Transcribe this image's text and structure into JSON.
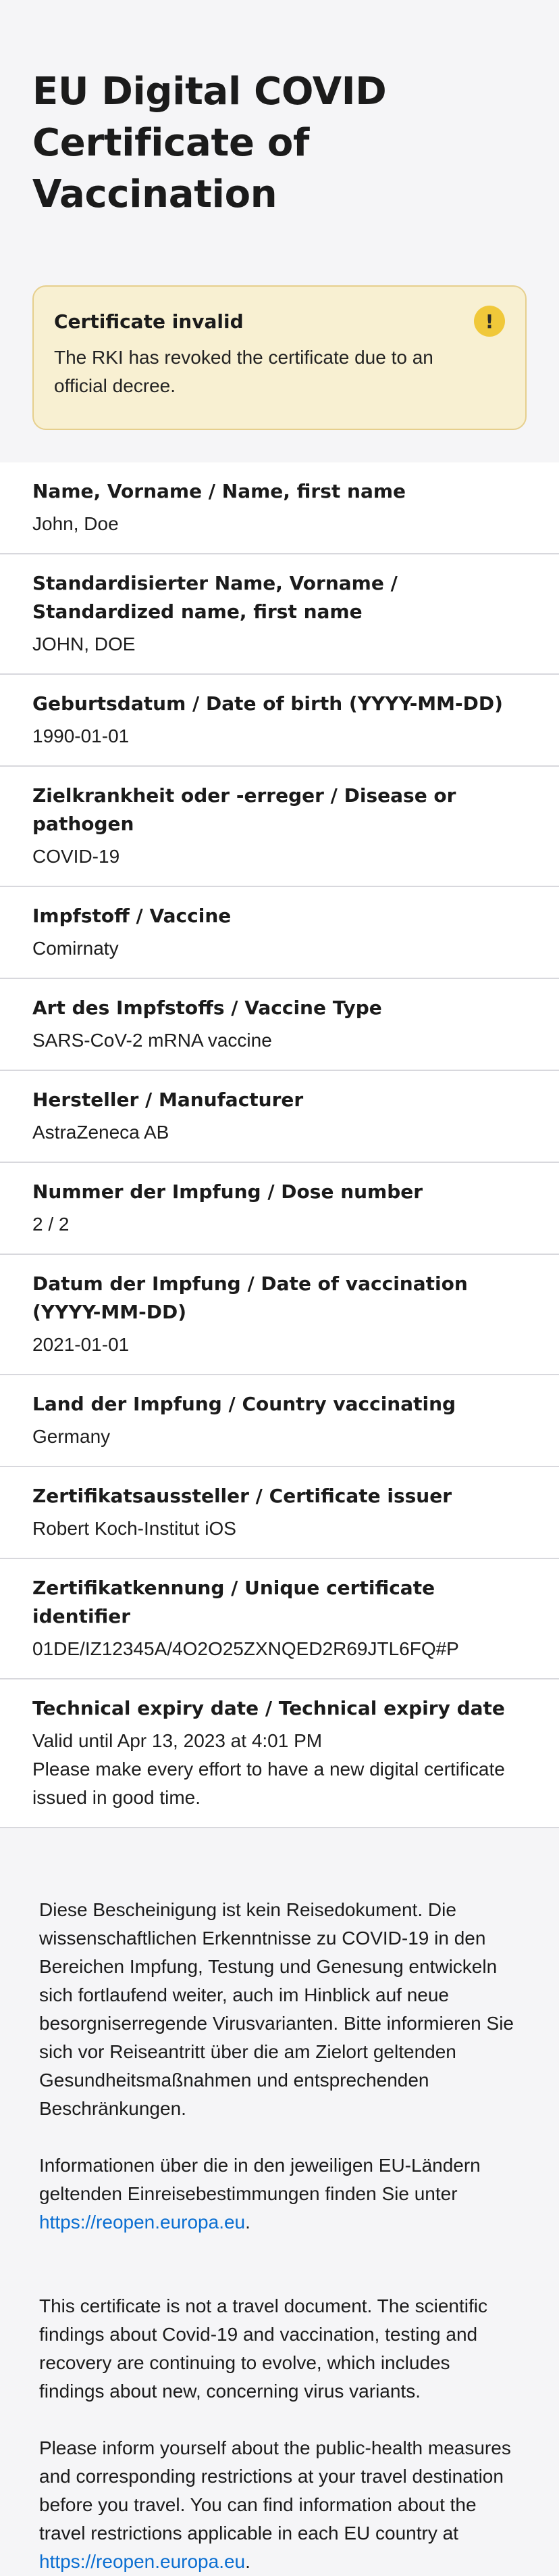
{
  "header": {
    "title": "EU Digital COVID Certificate of Vaccination"
  },
  "alert": {
    "title": "Certificate invalid",
    "text": "The RKI has revoked the certificate due to an official decree.",
    "icon": "exclamation-icon",
    "icon_glyph": "!"
  },
  "fields": [
    {
      "label": "Name, Vorname / Name, first name",
      "value": "John, Doe"
    },
    {
      "label": "Standardisierter Name, Vorname / Standardized name, first name",
      "value": "JOHN, DOE"
    },
    {
      "label": "Geburtsdatum / Date of birth (YYYY-MM-DD)",
      "value": "1990-01-01"
    },
    {
      "label": "Zielkrankheit oder -erreger / Disease or pathogen",
      "value": "COVID-19"
    },
    {
      "label": "Impfstoff / Vaccine",
      "value": "Comirnaty"
    },
    {
      "label": "Art des Impfstoffs / Vaccine Type",
      "value": "SARS-CoV-2 mRNA vaccine"
    },
    {
      "label": "Hersteller / Manufacturer",
      "value": "AstraZeneca AB"
    },
    {
      "label": "Nummer der Impfung / Dose number",
      "value": "2 / 2"
    },
    {
      "label": "Datum der Impfung / Date of vaccination (YYYY-MM-DD)",
      "value": "2021-01-01"
    },
    {
      "label": "Land der Impfung / Country vaccinating",
      "value": "Germany"
    },
    {
      "label": "Zertifikatsaussteller / Certificate issuer",
      "value": "Robert Koch-Institut iOS"
    },
    {
      "label": "Zertifikatkennung / Unique certificate identifier",
      "value": "01DE/IZ12345A/4O2O25ZXNQED2R69JTL6FQ#P"
    },
    {
      "label": "Technical expiry date / Technical expiry date",
      "value": "Valid until Apr 13, 2023 at 4:01 PM\nPlease make every effort to have a new digital certificate issued in good time."
    }
  ],
  "footer": {
    "de_para1": "Diese Bescheinigung ist kein Reisedokument. Die wissenschaftlichen Erkenntnisse zu COVID-19 in den Bereichen Impfung, Testung und Genesung entwickeln sich fortlaufend weiter, auch im Hinblick auf neue besorgniserregende Virusvarianten. Bitte informieren Sie sich vor Reiseantritt über die am Zielort geltenden Gesundheitsmaßnahmen und entsprechenden Beschränkungen.",
    "de_para2_prefix": "Informationen über die in den jeweiligen EU-Ländern geltenden Einreisebestimmungen finden Sie unter ",
    "de_link": "https://reopen.europa.eu",
    "de_para2_suffix": ".",
    "en_para1": "This certificate is not a travel document. The scientific findings about Covid-19 and vaccination, testing and recovery are continuing to evolve, which includes findings about new, concerning virus variants.",
    "en_para2_prefix": "Please inform yourself about the public-health measures and corresponding restrictions at your travel destination before you travel. You can find information about the travel restrictions applicable in each EU country at ",
    "en_link": "https://reopen.europa.eu",
    "en_para2_suffix": "."
  },
  "colors": {
    "background": "#f5f5f7",
    "alert_bg": "#f8f0d2",
    "alert_border": "#e6cf8d",
    "alert_icon": "#f0c83a",
    "link": "#0a6ed1"
  }
}
